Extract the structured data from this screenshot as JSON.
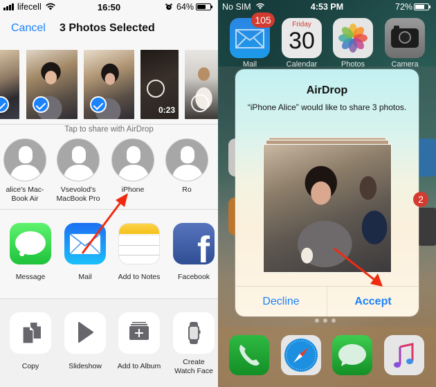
{
  "left_screen": {
    "status_bar": {
      "carrier": "lifecell",
      "time": "16:50",
      "battery_percent": "64%",
      "battery_level": 0.64,
      "icons": [
        "signal-icon",
        "wifi-icon",
        "alarm-icon",
        "battery-icon"
      ]
    },
    "nav": {
      "cancel_label": "Cancel",
      "title": "3 Photos Selected"
    },
    "photos": [
      {
        "kind": "photo",
        "selected": true
      },
      {
        "kind": "photo",
        "selected": true
      },
      {
        "kind": "photo",
        "selected": true
      },
      {
        "kind": "video",
        "selected": false,
        "duration": "0:23"
      },
      {
        "kind": "live-photo",
        "selected": false
      }
    ],
    "airdrop_hint": "Tap to share with AirDrop",
    "airdrop_targets": [
      {
        "label": "alice's Mac-\nBook Air"
      },
      {
        "label": "Vsevolod's\nMacBook Pro"
      },
      {
        "label": "iPhone"
      },
      {
        "label": "Ro"
      }
    ],
    "share_apps": [
      {
        "label": "Message",
        "icon": "message-icon"
      },
      {
        "label": "Mail",
        "icon": "mail-icon"
      },
      {
        "label": "Add to Notes",
        "icon": "notes-icon"
      },
      {
        "label": "Facebook",
        "icon": "facebook-icon"
      }
    ],
    "actions": [
      {
        "label": "Copy",
        "icon": "copy-icon"
      },
      {
        "label": "Slideshow",
        "icon": "play-icon"
      },
      {
        "label": "Add to Album",
        "icon": "add-album-icon"
      },
      {
        "label": "Create\nWatch Face",
        "icon": "watch-icon"
      }
    ]
  },
  "right_screen": {
    "status_bar": {
      "carrier": "No SIM",
      "time": "4:53 PM",
      "battery_percent": "72%",
      "battery_level": 0.72
    },
    "home_apps": [
      {
        "label": "Mail",
        "badge": "105"
      },
      {
        "label": "Calendar",
        "day_name": "Friday",
        "day_number": "30"
      },
      {
        "label": "Photos"
      },
      {
        "label": "Camera"
      }
    ],
    "partial_badge": "2",
    "alert": {
      "title": "AirDrop",
      "message": "“iPhone Alice” would like to share 3 photos.",
      "decline_label": "Decline",
      "accept_label": "Accept"
    },
    "dock_apps": [
      "Phone",
      "Safari",
      "Messages",
      "Music"
    ]
  },
  "annotations": {
    "arrow_color": "#f02a12"
  },
  "colors": {
    "ios_blue": "#1a82fb",
    "badge_red": "#d33b30"
  }
}
